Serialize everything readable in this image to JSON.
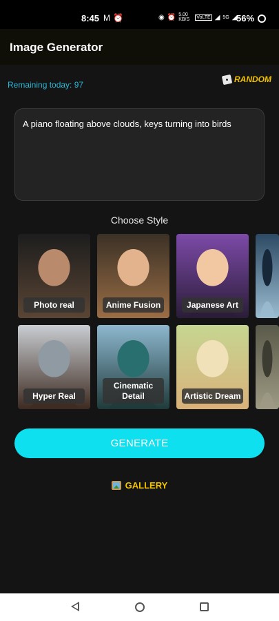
{
  "status": {
    "time": "8:45",
    "left_icons": [
      "gmail-icon",
      "alarm-icon"
    ],
    "data_speed": "5.00 KB/S",
    "network_badge": "VoLTE",
    "signal": "5G",
    "battery": "56%"
  },
  "app": {
    "title": "Image Generator"
  },
  "remaining": "Remaining today: 97",
  "random_label": "RANDOM",
  "prompt_text": "A piano floating above clouds, keys turning into birds",
  "choose_style": "Choose Style",
  "styles_row1": [
    {
      "label": "Photo real",
      "colors": [
        "#1d1d1d",
        "#5a4534",
        "#b98a6c"
      ]
    },
    {
      "label": "Anime Fusion",
      "colors": [
        "#3b3126",
        "#9a6d45",
        "#e2b38d"
      ]
    },
    {
      "label": "Japanese Art",
      "colors": [
        "#7d4aa8",
        "#2a1d38",
        "#f2c8a2"
      ]
    },
    {
      "label": "",
      "colors": [
        "#2c4a63",
        "#9bbcd1",
        "#16283a"
      ]
    }
  ],
  "styles_row2": [
    {
      "label": "Hyper Real",
      "colors": [
        "#c9cdd2",
        "#3d2a20",
        "#8f9aa3"
      ]
    },
    {
      "label": "Cinematic Detail",
      "colors": [
        "#8eb8cf",
        "#1f3a3a",
        "#2a6f6f"
      ]
    },
    {
      "label": "Artistic Dream",
      "colors": [
        "#c6d691",
        "#d9b17a",
        "#f1e1b9"
      ]
    },
    {
      "label": "",
      "colors": [
        "#5a5a4a",
        "#9e9a84",
        "#3c3c32"
      ]
    }
  ],
  "generate_label": "GENERATE",
  "gallery_label": "GALLERY",
  "accent": {
    "cyan": "#0ee0ef",
    "yellow": "#f2c200",
    "link": "#2cb6d6"
  }
}
